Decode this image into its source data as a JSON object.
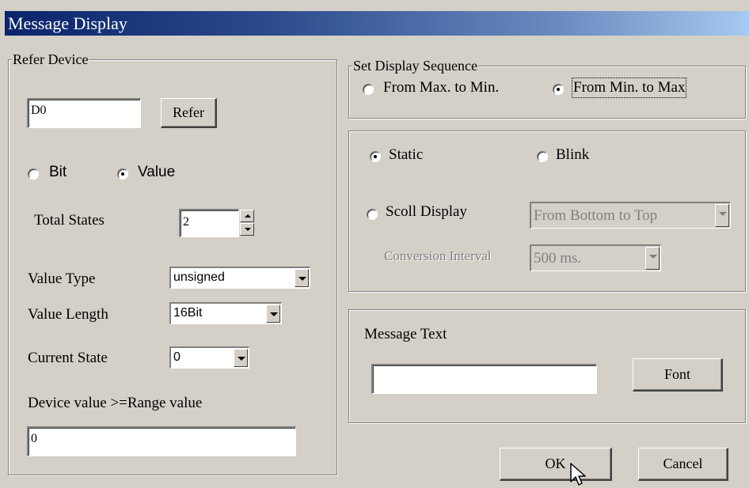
{
  "window": {
    "title": "Message Display"
  },
  "refer_device": {
    "legend": "Refer Device",
    "device_value": "D0",
    "refer_label": "Refer",
    "radio_bit": "Bit",
    "radio_value": "Value",
    "selected_mode": "Value",
    "total_states_label": "Total States",
    "total_states_value": "2",
    "value_type_label": "Value Type",
    "value_type_value": "unsigned",
    "value_length_label": "Value Length",
    "value_length_value": "16Bit",
    "current_state_label": "Current State",
    "current_state_value": "0",
    "range_label": "Device value >=Range value",
    "range_value": "0"
  },
  "sequence": {
    "legend": "Set Display Sequence",
    "max_to_min": "From Max. to Min.",
    "min_to_max": "From Min. to Max",
    "selected": "From Min. to Max"
  },
  "display": {
    "static": "Static",
    "blink": "Blink",
    "scroll": "Scoll Display",
    "selected": "Static",
    "scroll_direction": "From Bottom to Top",
    "interval_label": "Conversion Interval",
    "interval_value": "500 ms."
  },
  "message": {
    "label": "Message Text",
    "text": "",
    "font_label": "Font"
  },
  "buttons": {
    "ok": "OK",
    "cancel": "Cancel"
  },
  "colors": {
    "dialog": "#d4d0c8",
    "title_start": "#0a246a",
    "title_end": "#a6caf0"
  }
}
